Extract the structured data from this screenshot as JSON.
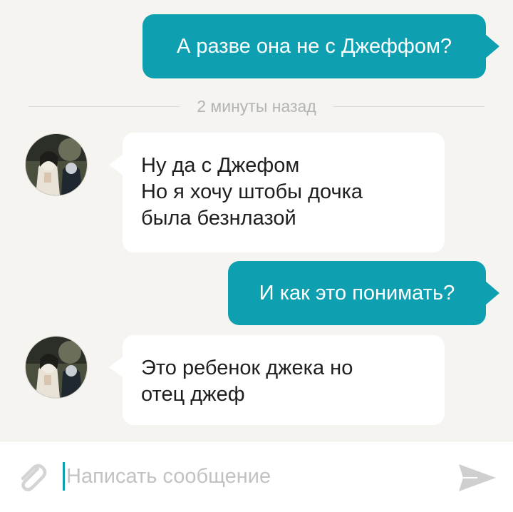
{
  "messages": [
    {
      "direction": "outgoing",
      "lines": [
        "А разве она не с Джеффом?"
      ]
    },
    {
      "direction": "incoming",
      "lines": [
        "Ну да с Джефом",
        "Но я хочу штобы дочка",
        "была безнлазой"
      ]
    },
    {
      "direction": "outgoing",
      "lines": [
        "И как это понимать?"
      ]
    },
    {
      "direction": "incoming",
      "lines": [
        "Это ребенок джека но",
        "отец джеф"
      ]
    }
  ],
  "timestamp_divider": "2 минуты назад",
  "composer": {
    "placeholder": "Написать сообщение",
    "attach_icon": "paperclip-icon",
    "send_icon": "send-arrow-icon"
  },
  "colors": {
    "accent": "#0e9fb1",
    "background": "#f5f4f1",
    "incoming_bubble": "#ffffff"
  }
}
